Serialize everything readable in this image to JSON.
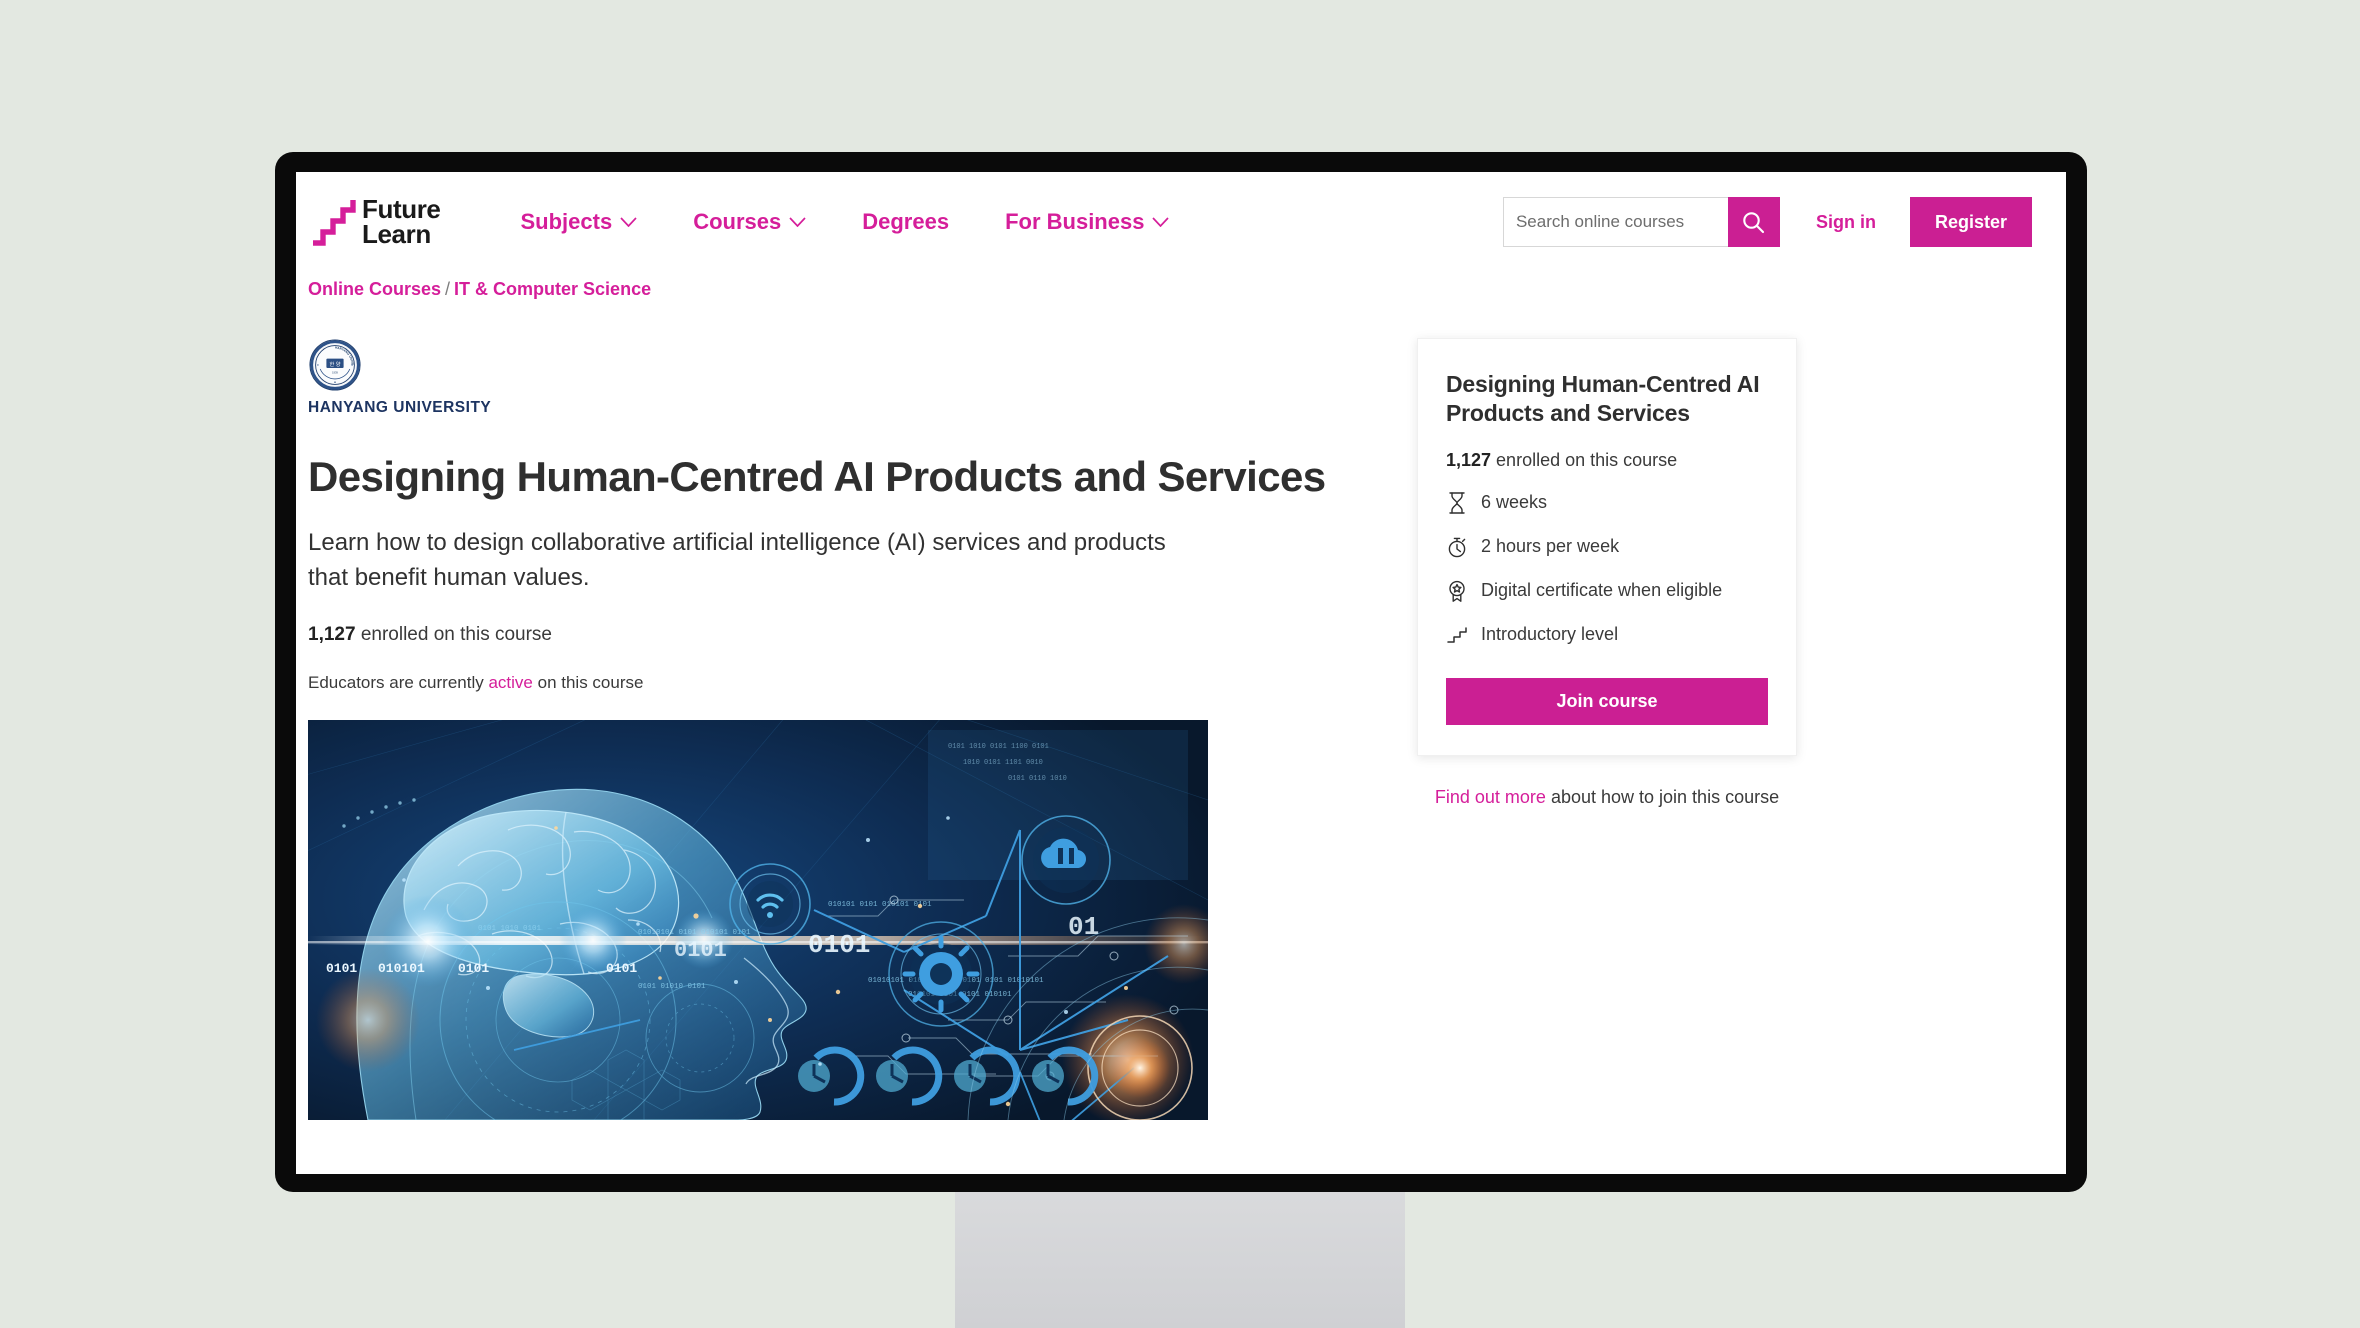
{
  "header": {
    "logo": {
      "line1": "Future",
      "line2": "Learn",
      "icon": "stairs-icon"
    },
    "nav": [
      {
        "label": "Subjects",
        "has_dropdown": true
      },
      {
        "label": "Courses",
        "has_dropdown": true
      },
      {
        "label": "Degrees",
        "has_dropdown": false
      },
      {
        "label": "For Business",
        "has_dropdown": true
      }
    ],
    "search": {
      "placeholder": "Search online courses",
      "value": "",
      "icon": "search-icon"
    },
    "sign_in_label": "Sign in",
    "register_label": "Register"
  },
  "breadcrumb": {
    "items": [
      "Online Courses",
      "IT & Computer Science"
    ],
    "separator": "/"
  },
  "provider": {
    "name": "HANYANG UNIVERSITY",
    "seal_text_top": "HANYANG UNIVERSITY",
    "seal_year": "1939"
  },
  "course": {
    "title": "Designing Human-Centred AI Products and Services",
    "strapline": "Learn how to design collaborative artificial intelligence (AI) services and products that benefit human values.",
    "enrolled_count": "1,127",
    "enrolled_suffix": " enrolled on this course",
    "educator_prefix": "Educators are currently ",
    "educator_status": "active",
    "educator_suffix": " on this course"
  },
  "card": {
    "title": "Designing Human-Centred AI Products and Services",
    "enrolled_count": "1,127",
    "enrolled_suffix": " enrolled on this course",
    "facts": [
      {
        "icon": "hourglass-icon",
        "label": "6 weeks"
      },
      {
        "icon": "stopwatch-icon",
        "label": "2 hours per week"
      },
      {
        "icon": "award-ribbon-icon",
        "label": "Digital certificate when eligible"
      },
      {
        "icon": "stairs-level-icon",
        "label": "Introductory level"
      }
    ],
    "join_label": "Join course",
    "find_out_more_link": "Find out more",
    "find_out_more_rest": " about how to join this course"
  },
  "hero": {
    "alt": "Illustration of a human head profile with a glowing brain, binary digits and connected technology icons",
    "binary_labels": [
      "0101",
      "0101",
      "01010101",
      "0101",
      "010101",
      "0101",
      "01"
    ],
    "node_icons": [
      "wifi-icon",
      "gear-icon",
      "cloud-upload-icon",
      "gauge-icon"
    ]
  },
  "colors": {
    "brand_magenta": "#cb1f93",
    "link_magenta": "#d51e9a",
    "page_background": "#e3e8e1",
    "provider_navy": "#1d3461",
    "hero_deep_blue": "#0c1c33",
    "bezel_black": "#0a0a0a",
    "stand_grey": "#d5d6d8"
  }
}
